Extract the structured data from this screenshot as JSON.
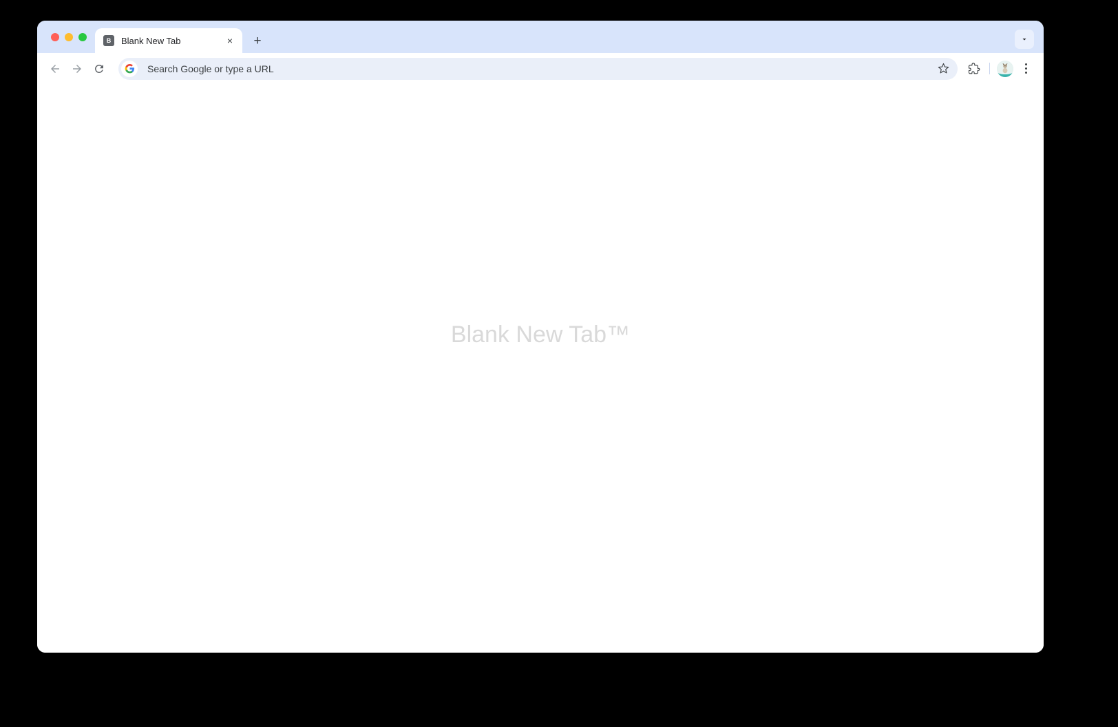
{
  "window": {
    "title": "Blank New Tab"
  },
  "titlebar": {
    "traffic_lights": [
      {
        "name": "close",
        "color": "#ff5f57"
      },
      {
        "name": "minimize",
        "color": "#febc2e"
      },
      {
        "name": "zoom",
        "color": "#28c840"
      }
    ],
    "tab_strip_bg": "#d8e4fb"
  },
  "tabs": [
    {
      "title": "Blank New Tab",
      "favicon_letter": "B",
      "favicon_bg": "#5f6368",
      "close_label": "×",
      "active": true
    }
  ],
  "tab_actions": {
    "new_tab_label": "+",
    "tab_list_label": "tab-list"
  },
  "toolbar": {
    "back_label": "←",
    "forward_label": "→",
    "reload_label": "reload",
    "omnibox": {
      "placeholder": "Search Google or type a URL",
      "value": "",
      "display_text": "Search Google or type a URL",
      "background": "#eaeff9",
      "search_engine": "google"
    },
    "bookmark_label": "bookmark-star",
    "extensions_label": "extensions",
    "profile_label": "profile",
    "menu_label": "chrome-menu"
  },
  "page": {
    "watermark": "Blank New Tab™",
    "watermark_color": "#d9d9d9",
    "background": "#ffffff"
  },
  "colors": {
    "desktop_background": "#000000",
    "window_background": "#ffffff",
    "accent": "#d8e4fb"
  }
}
